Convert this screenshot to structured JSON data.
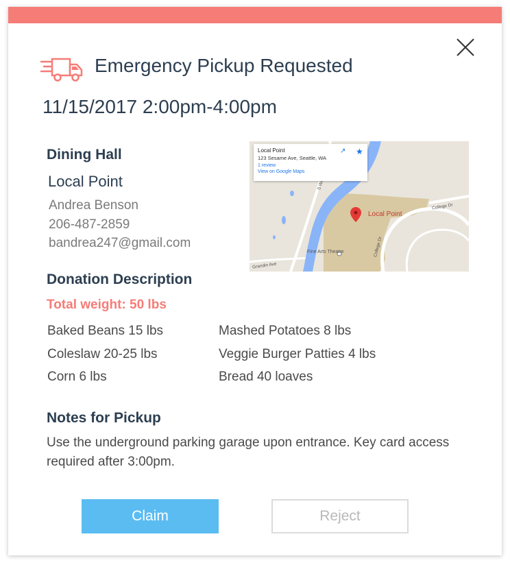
{
  "modal": {
    "accent_color": "#f57c77",
    "title": "Emergency Pickup Requested",
    "datetime": "11/15/2017 2:00pm-4:00pm",
    "icons": {
      "header": "truck-icon",
      "close": "close-icon"
    }
  },
  "location": {
    "heading": "Dining Hall",
    "name": "Local Point",
    "contact_name": "Andrea Benson",
    "phone": "206-487-2859",
    "email": "bandrea247@gmail.com"
  },
  "map": {
    "card_title": "Local Point",
    "card_address": "123 Sesame Ave, Seattle, WA",
    "card_reviews": "1 review",
    "card_link": "View on Google Maps",
    "place_label": "Local Point",
    "landmark_label": "Fine Arts Theatre",
    "icons": {
      "directions": "directions-icon",
      "save": "star-icon",
      "pin": "map-pin-icon"
    }
  },
  "donation": {
    "heading": "Donation Description",
    "total_weight": "Total weight: 50 lbs",
    "items_left": [
      "Baked Beans 15 lbs",
      "Coleslaw  20-25 lbs",
      "Corn  6 lbs"
    ],
    "items_right": [
      "Mashed Potatoes  8 lbs",
      "Veggie Burger Patties  4 lbs",
      "Bread  40 loaves"
    ]
  },
  "notes": {
    "heading": "Notes for Pickup",
    "text": "Use the underground parking garage upon entrance. Key card access required after 3:00pm."
  },
  "actions": {
    "claim_label": "Claim",
    "claim_color": "#5bbcf2",
    "reject_label": "Reject"
  }
}
